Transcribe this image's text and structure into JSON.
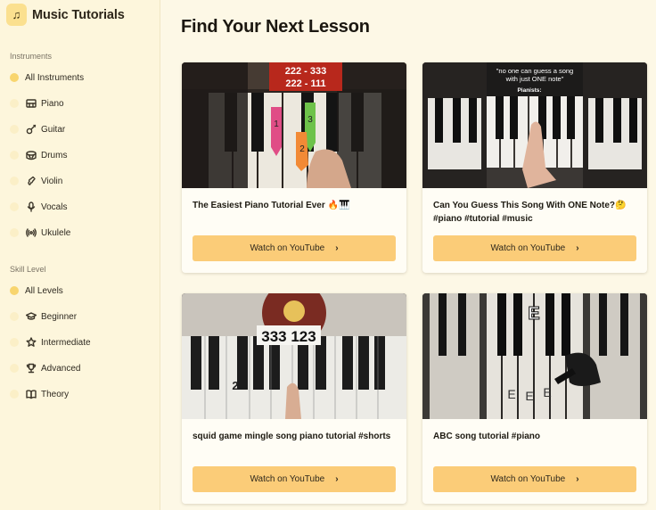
{
  "app": {
    "title": "Music Tutorials",
    "logo_icon": "music-note-icon"
  },
  "sidebar": {
    "instruments_label": "Instruments",
    "instruments": [
      {
        "label": "All Instruments",
        "icon": null,
        "active": true
      },
      {
        "label": "Piano",
        "icon": "piano-icon",
        "active": false
      },
      {
        "label": "Guitar",
        "icon": "guitar-icon",
        "active": false
      },
      {
        "label": "Drums",
        "icon": "drum-icon",
        "active": false
      },
      {
        "label": "Violin",
        "icon": "violin-icon",
        "active": false
      },
      {
        "label": "Vocals",
        "icon": "microphone-icon",
        "active": false
      },
      {
        "label": "Ukulele",
        "icon": "radio-waves-icon",
        "active": false
      }
    ],
    "skill_label": "Skill Level",
    "skills": [
      {
        "label": "All Levels",
        "icon": null,
        "active": true
      },
      {
        "label": "Beginner",
        "icon": "graduation-cap-icon",
        "active": false
      },
      {
        "label": "Intermediate",
        "icon": "star-icon",
        "active": false
      },
      {
        "label": "Advanced",
        "icon": "trophy-icon",
        "active": false
      },
      {
        "label": "Theory",
        "icon": "book-icon",
        "active": false
      }
    ]
  },
  "main": {
    "title": "Find Your Next Lesson",
    "cards": [
      {
        "title": "The Easiest Piano Tutorial Ever 🔥🎹",
        "button": "Watch on YouTube",
        "thumb_text": [
          "222 - 333",
          "222 - 111"
        ]
      },
      {
        "title": "Can You Guess This Song With ONE Note?🤔 #piano #tutorial #music",
        "button": "Watch on YouTube",
        "thumb_text": [
          "\"no one can guess a song",
          "with just ONE note\"",
          "Pianists:"
        ]
      },
      {
        "title": "squid game mingle song piano tutorial #shorts",
        "button": "Watch on YouTube",
        "thumb_text": [
          "333 123"
        ]
      },
      {
        "title": "ABC song tutorial #piano",
        "button": "Watch on YouTube",
        "thumb_text": [
          "E"
        ]
      }
    ]
  },
  "colors": {
    "accent": "#fbcc78",
    "active_dot": "#f8d56e",
    "background": "#fdf8e6"
  }
}
